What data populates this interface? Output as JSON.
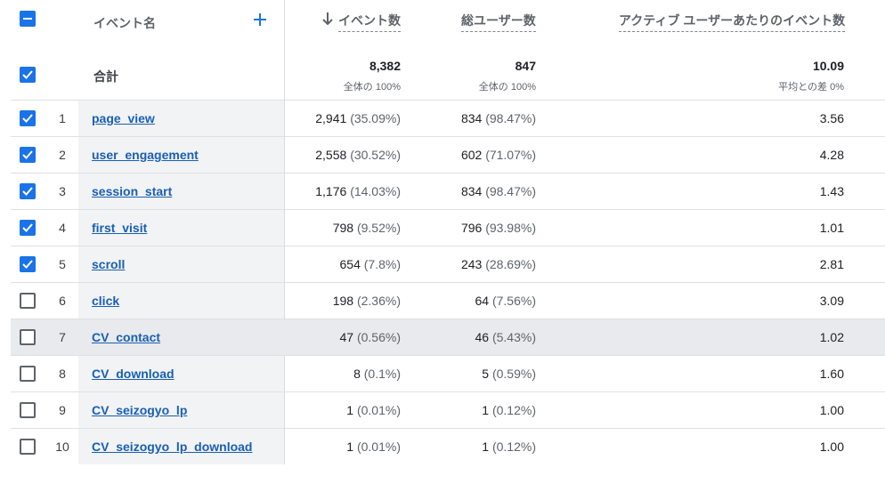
{
  "header": {
    "event_name": "イベント名",
    "add_icon": "plus-icon",
    "sort_icon": "arrow-down-icon",
    "col_events": "イベント数",
    "col_users": "総ユーザー数",
    "col_per_user": "アクティブ ユーザーあたりのイベント数"
  },
  "totals": {
    "label": "合計",
    "events": "8,382",
    "events_sub": "全体の 100%",
    "users": "847",
    "users_sub": "全体の 100%",
    "per_user": "10.09",
    "per_user_sub": "平均との差 0%"
  },
  "colors": {
    "accent": "#1a73e8",
    "link": "#1a5fb4"
  },
  "rows": [
    {
      "idx": "1",
      "name": "page_view",
      "events": "2,941",
      "events_pct": "(35.09%)",
      "users": "834",
      "users_pct": "(98.47%)",
      "per_user": "3.56",
      "checked": true
    },
    {
      "idx": "2",
      "name": "user_engagement",
      "events": "2,558",
      "events_pct": "(30.52%)",
      "users": "602",
      "users_pct": "(71.07%)",
      "per_user": "4.28",
      "checked": true
    },
    {
      "idx": "3",
      "name": "session_start",
      "events": "1,176",
      "events_pct": "(14.03%)",
      "users": "834",
      "users_pct": "(98.47%)",
      "per_user": "1.43",
      "checked": true
    },
    {
      "idx": "4",
      "name": "first_visit",
      "events": "798",
      "events_pct": "(9.52%)",
      "users": "796",
      "users_pct": "(93.98%)",
      "per_user": "1.01",
      "checked": true
    },
    {
      "idx": "5",
      "name": "scroll",
      "events": "654",
      "events_pct": "(7.8%)",
      "users": "243",
      "users_pct": "(28.69%)",
      "per_user": "2.81",
      "checked": true
    },
    {
      "idx": "6",
      "name": "click",
      "events": "198",
      "events_pct": "(2.36%)",
      "users": "64",
      "users_pct": "(7.56%)",
      "per_user": "3.09",
      "checked": false
    },
    {
      "idx": "7",
      "name": "CV_contact",
      "events": "47",
      "events_pct": "(0.56%)",
      "users": "46",
      "users_pct": "(5.43%)",
      "per_user": "1.02",
      "checked": false
    },
    {
      "idx": "8",
      "name": "CV_download",
      "events": "8",
      "events_pct": "(0.1%)",
      "users": "5",
      "users_pct": "(0.59%)",
      "per_user": "1.60",
      "checked": false
    },
    {
      "idx": "9",
      "name": "CV_seizogyo_lp",
      "events": "1",
      "events_pct": "(0.01%)",
      "users": "1",
      "users_pct": "(0.12%)",
      "per_user": "1.00",
      "checked": false
    },
    {
      "idx": "10",
      "name": "CV_seizogyo_lp_download",
      "events": "1",
      "events_pct": "(0.01%)",
      "users": "1",
      "users_pct": "(0.12%)",
      "per_user": "1.00",
      "checked": false
    }
  ]
}
